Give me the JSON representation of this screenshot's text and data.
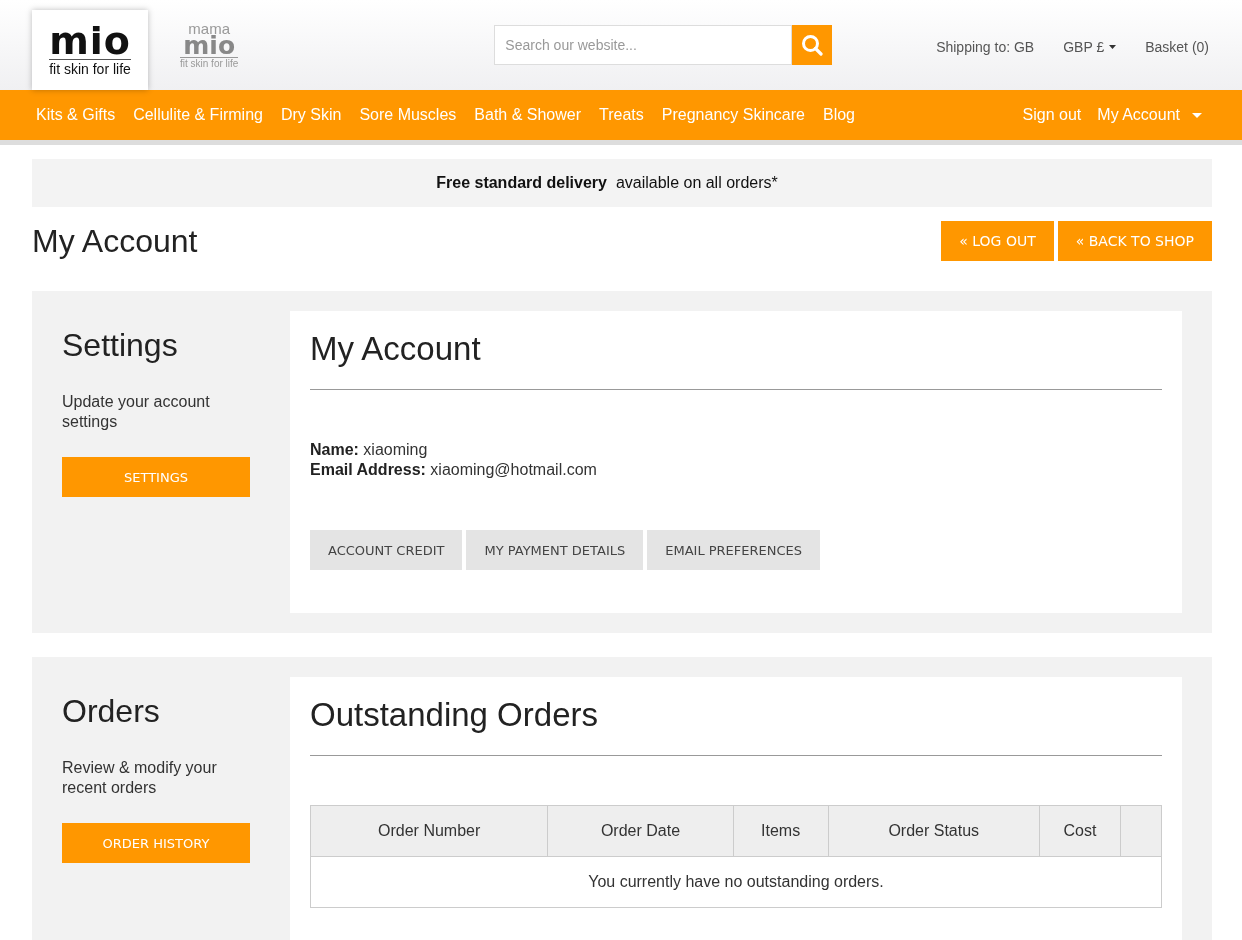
{
  "header": {
    "logo": {
      "name": "mio",
      "tagline": "fit skin for life"
    },
    "sub_logo": {
      "top": "mama",
      "name": "mio",
      "tagline": "fit skin for life"
    },
    "search": {
      "placeholder": "Search our website..."
    },
    "shipping": "Shipping to: GB",
    "currency": "GBP £",
    "basket": "Basket (0)"
  },
  "nav": {
    "items": [
      "Kits & Gifts",
      "Cellulite & Firming",
      "Dry Skin",
      "Sore Muscles",
      "Bath & Shower",
      "Treats",
      "Pregnancy Skincare",
      "Blog"
    ],
    "sign_out": "Sign out",
    "account": "My Account"
  },
  "banner": "**Free standard delivery**  available on all orders*",
  "page": {
    "title": "My Account",
    "buttons": [
      "« LOG OUT",
      "« BACK TO SHOP"
    ]
  },
  "sections": [
    {
      "kind": "account",
      "side_title": "Settings",
      "side_text": "Update your account settings",
      "side_button": "SETTINGS",
      "title": "My Account",
      "fields": [
        {
          "label": "Name:",
          "value": "xiaoming"
        },
        {
          "label": "Email Address:",
          "value": "xiaoming@hotmail.com"
        }
      ],
      "tabs": [
        "ACCOUNT CREDIT",
        "MY PAYMENT DETAILS",
        "EMAIL PREFERENCES"
      ]
    },
    {
      "kind": "orders",
      "side_title": "Orders",
      "side_text": "Review & modify your recent orders",
      "side_button": "ORDER HISTORY",
      "title": "Outstanding Orders",
      "table": {
        "columns": [
          "Order Number",
          "Order Date",
          "Items",
          "Order Status",
          "Cost"
        ],
        "empty_message": "You currently have no outstanding orders."
      }
    }
  ]
}
